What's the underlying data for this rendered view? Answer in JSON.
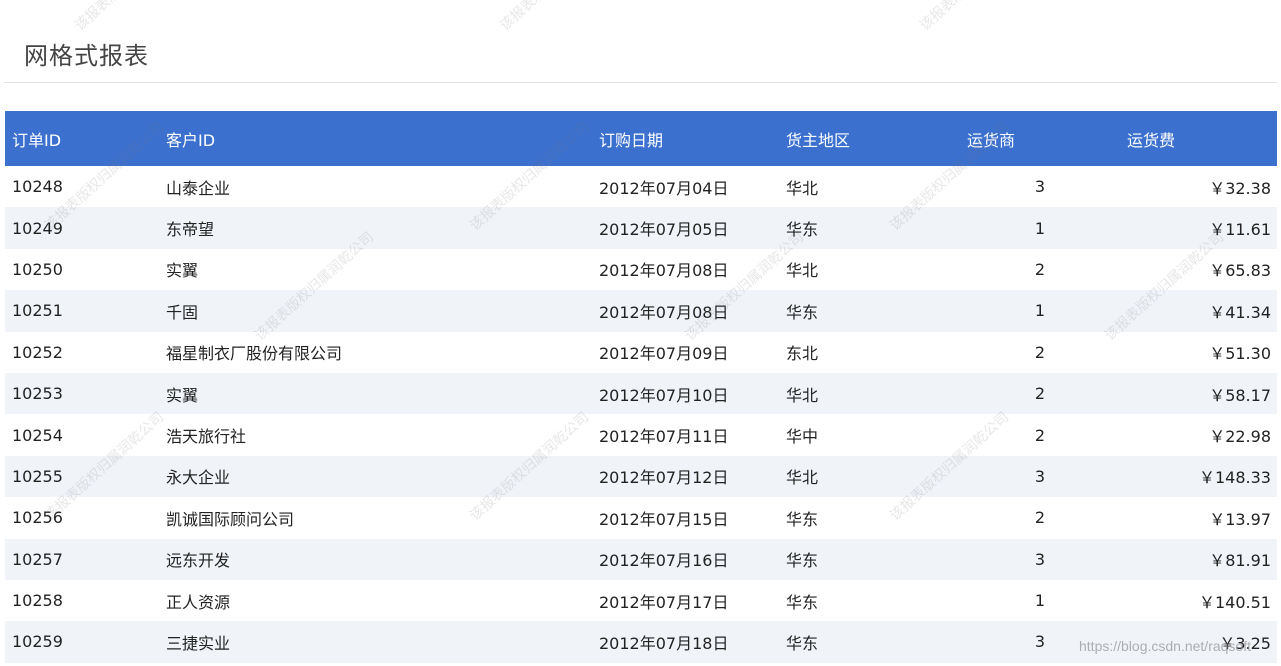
{
  "report": {
    "title": "网格式报表"
  },
  "columns": [
    "订单ID",
    "客户ID",
    "订购日期",
    "货主地区",
    "运货商",
    "运货费"
  ],
  "rows": [
    [
      "10248",
      "山泰企业",
      "2012年07月04日",
      "华北",
      "3",
      "￥32.38"
    ],
    [
      "10249",
      "东帝望",
      "2012年07月05日",
      "华东",
      "1",
      "￥11.61"
    ],
    [
      "10250",
      "实翼",
      "2012年07月08日",
      "华北",
      "2",
      "￥65.83"
    ],
    [
      "10251",
      "千固",
      "2012年07月08日",
      "华东",
      "1",
      "￥41.34"
    ],
    [
      "10252",
      "福星制衣厂股份有限公司",
      "2012年07月09日",
      "东北",
      "2",
      "￥51.30"
    ],
    [
      "10253",
      "实翼",
      "2012年07月10日",
      "华北",
      "2",
      "￥58.17"
    ],
    [
      "10254",
      "浩天旅行社",
      "2012年07月11日",
      "华中",
      "2",
      "￥22.98"
    ],
    [
      "10255",
      "永大企业",
      "2012年07月12日",
      "华北",
      "3",
      "￥148.33"
    ],
    [
      "10256",
      "凯诚国际顾问公司",
      "2012年07月15日",
      "华东",
      "2",
      "￥13.97"
    ],
    [
      "10257",
      "远东开发",
      "2012年07月16日",
      "华东",
      "3",
      "￥81.91"
    ],
    [
      "10258",
      "正人资源",
      "2012年07月17日",
      "华东",
      "1",
      "￥140.51"
    ],
    [
      "10259",
      "三捷实业",
      "2012年07月18日",
      "华东",
      "3",
      "￥3.25"
    ]
  ],
  "watermark": {
    "text": "该报表版权归属润乾公司"
  },
  "source_watermark": "https://blog.csdn.net/raqsoft",
  "colors": {
    "header_bg": "#3b70cf",
    "header_text": "#ffffff",
    "row_alt_bg": "#f0f4f9",
    "row_bg": "#ffffff"
  }
}
